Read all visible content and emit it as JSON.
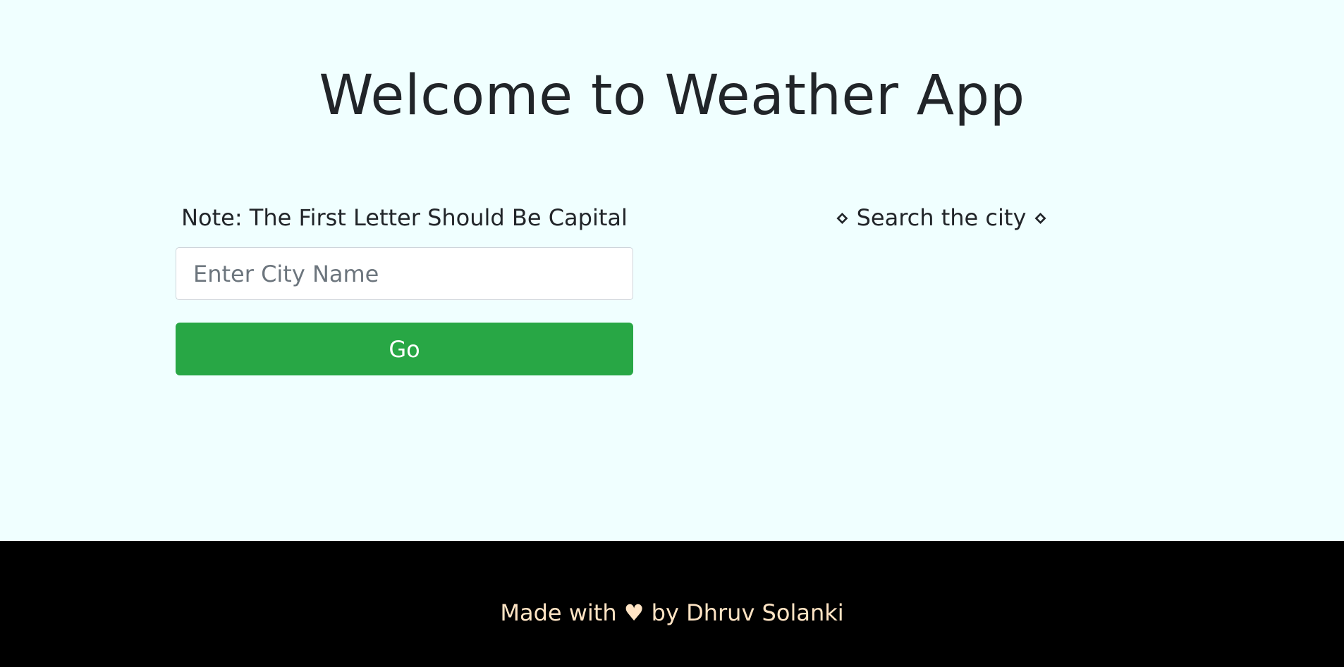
{
  "header": {
    "title": "Welcome to Weather App"
  },
  "search": {
    "note": "Note: The First Letter Should Be Capital",
    "placeholder": "Enter City Name",
    "value": "",
    "button_label": "Go"
  },
  "result": {
    "hint": "⋄ Search the city ⋄"
  },
  "footer": {
    "prefix": "Made with",
    "heart": "♥",
    "suffix": "by Dhruv Solanki",
    "icon": "heart-icon"
  },
  "colors": {
    "page_background": "#f0ffff",
    "button_background": "#28a745",
    "footer_background": "#000000",
    "footer_text": "#ffe4c4"
  }
}
